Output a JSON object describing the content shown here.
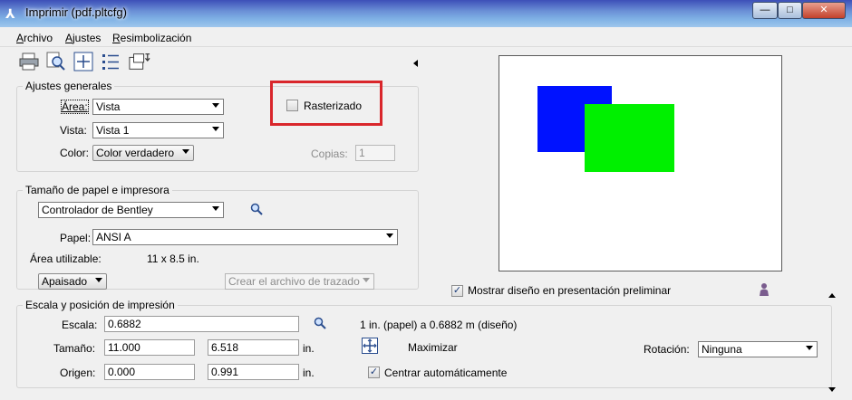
{
  "window": {
    "title": "Imprimir  (pdf.pltcfg)",
    "min_symbol": "—",
    "max_symbol": "□",
    "close_symbol": "✕"
  },
  "menu": [
    {
      "pre": "",
      "key": "A",
      "post": "rchivo"
    },
    {
      "pre": "",
      "key": "A",
      "post": "justes"
    },
    {
      "pre": "",
      "key": "R",
      "post": "esimbolización"
    }
  ],
  "toolbar": {
    "icons": [
      "printer-icon",
      "preview-zoom-icon",
      "fit-view-icon",
      "list-icon",
      "page-setup-icon"
    ]
  },
  "general": {
    "legend": "Ajustes generales",
    "area_label": "Área:",
    "area_value": "Vista",
    "view_label": "Vista:",
    "view_value": "Vista 1",
    "color_label": "Color:",
    "color_value": "Color verdadero",
    "rasterize_label": "Rasterizado",
    "rasterize_checked": false,
    "copies_label": "Copias:",
    "copies_value": "1"
  },
  "paper": {
    "legend": "Tamaño de papel e impresora",
    "driver_value": "Controlador de Bentley",
    "paper_label": "Papel:",
    "paper_value": "ANSI A",
    "usable_label": "Área utilizable:",
    "usable_value": "11 x 8.5 in.",
    "orientation_value": "Apaisado",
    "plotfile_value": "Crear el archivo de trazado"
  },
  "preview": {
    "show_label": "Mostrar diseño en presentación preliminar",
    "show_checked": true,
    "colors": {
      "blue": "#0012ff",
      "green": "#00f000"
    }
  },
  "scale": {
    "legend": "Escala y posición de impresión",
    "scale_label": "Escala:",
    "scale_value": "0.6882",
    "scale_info": "1 in. (papel) a 0.6882 m (diseño)",
    "size_label": "Tamaño:",
    "size_w": "11.000",
    "size_h": "6.518",
    "size_unit": "in.",
    "maximize_label": "Maximizar",
    "rotation_label": "Rotación:",
    "rotation_value": "Ninguna",
    "origin_label": "Origen:",
    "origin_x": "0.000",
    "origin_y": "0.991",
    "origin_unit": "in.",
    "center_label": "Centrar automáticamente",
    "center_checked": true
  }
}
